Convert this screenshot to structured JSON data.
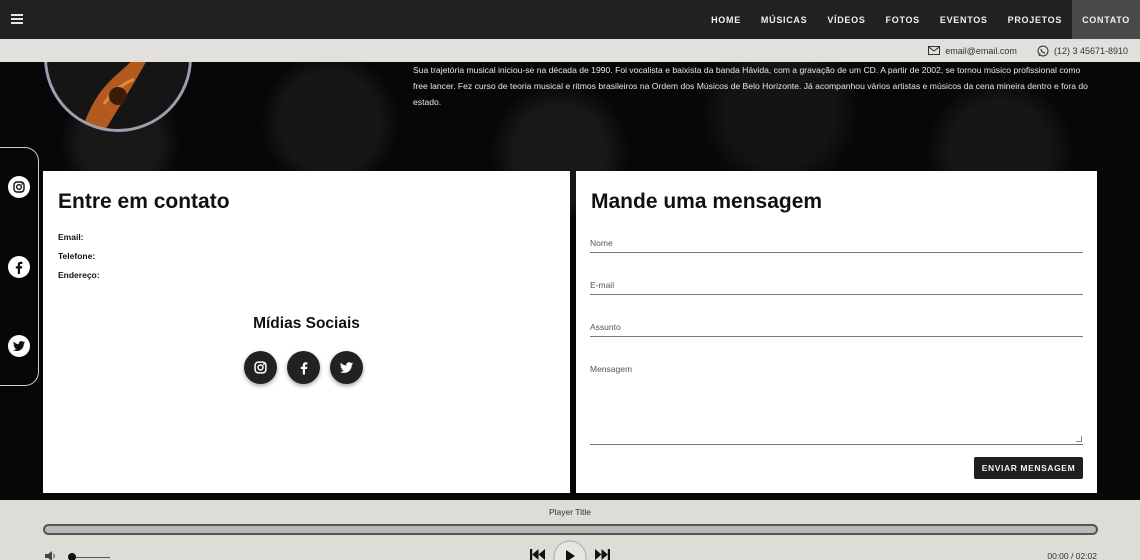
{
  "nav": {
    "items": [
      {
        "label": "HOME",
        "active": false
      },
      {
        "label": "MÚSICAS",
        "active": false
      },
      {
        "label": "VÍDEOS",
        "active": false
      },
      {
        "label": "FOTOS",
        "active": false
      },
      {
        "label": "EVENTOS",
        "active": false
      },
      {
        "label": "PROJETOS",
        "active": false
      },
      {
        "label": "CONTATO",
        "active": true
      }
    ]
  },
  "contact_strip": {
    "email": "email@email.com",
    "phone": "(12) 3 45671-8910"
  },
  "bio": {
    "text": "Sua trajetória musical iniciou-se na década de 1990. Foi vocalista e baixista da banda Hávida, com a gravação de um CD. A partir de 2002, se tornou músico profissional como free lancer. Fez curso de teoria musical e ritmos brasileiros na Ordem dos Músicos de Belo Horizonte. Já acompanhou vários artistas e músicos da cena mineira dentro e fora do estado."
  },
  "contact_panel": {
    "title": "Entre em contato",
    "email_label": "Email:",
    "phone_label": "Telefone:",
    "address_label": "Endereço:",
    "social_title": "Mídias Sociais"
  },
  "message_panel": {
    "title": "Mande uma mensagem",
    "name_placeholder": "Nome",
    "email_placeholder": "E-mail",
    "subject_placeholder": "Assunto",
    "message_placeholder": "Mensagem",
    "send_label": "ENVIAR MENSAGEM"
  },
  "social_icons": [
    "instagram-icon",
    "facebook-icon",
    "twitter-icon"
  ],
  "player": {
    "title": "Player Title",
    "time": "00:00 / 02:02",
    "progress": 0.0,
    "volume": 0.1
  },
  "colors": {
    "nav_bg": "#212121",
    "strip_bg": "#e1e0dc",
    "player_bg": "#dddcd7",
    "button_bg": "#1f1f1f"
  }
}
